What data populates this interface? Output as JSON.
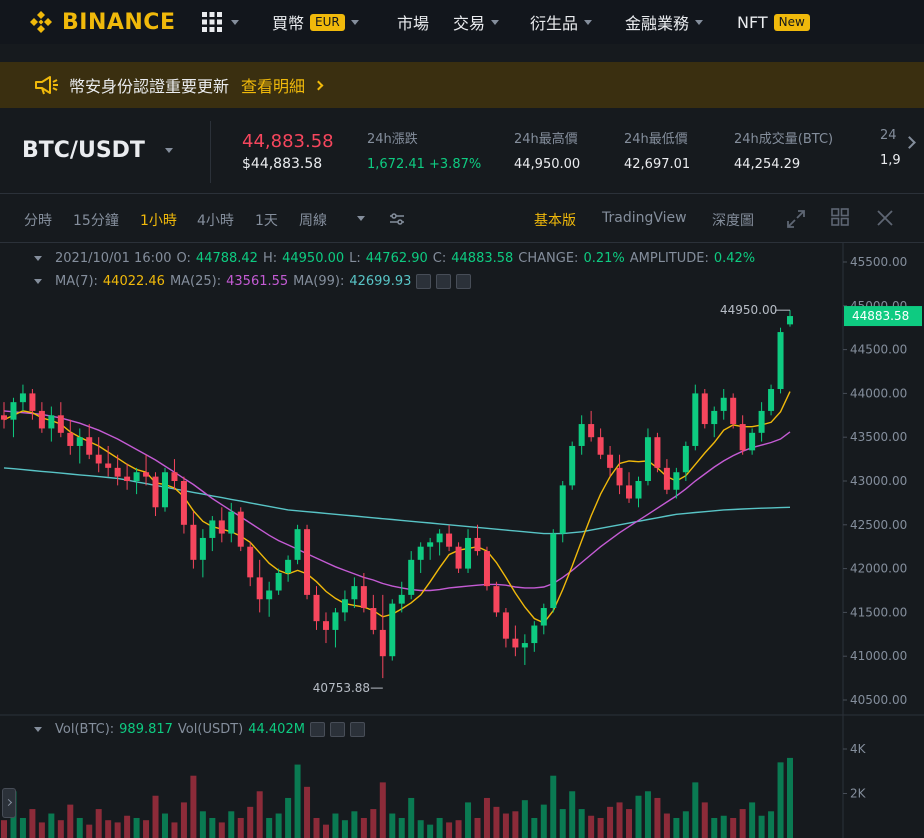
{
  "brand": {
    "name": "BINANCE",
    "color": "#f0b90b"
  },
  "nav": {
    "grid_icon": "grid-icon",
    "items": [
      {
        "label": "買幣",
        "badge": "EUR",
        "has_caret": true
      },
      {
        "label": "市場",
        "badge": "",
        "has_caret": false
      },
      {
        "label": "交易",
        "badge": "",
        "has_caret": true
      },
      {
        "label": "衍生品",
        "badge": "",
        "has_caret": true
      },
      {
        "label": "金融業務",
        "badge": "",
        "has_caret": true
      },
      {
        "label": "NFT",
        "badge": "New",
        "has_caret": false
      }
    ]
  },
  "banner": {
    "icon": "megaphone-icon",
    "text": "幣安身份認證重要更新",
    "link": "查看明細"
  },
  "ticker": {
    "pair": "BTC/USDT",
    "last_price": "44,883.58",
    "last_price_usd": "$44,883.58",
    "stats": [
      {
        "label": "24h漲跌",
        "value": "1,672.41 +3.87%",
        "green": true
      },
      {
        "label": "24h最高價",
        "value": "44,950.00",
        "green": false
      },
      {
        "label": "24h最低價",
        "value": "42,697.01",
        "green": false
      },
      {
        "label": "24h成交量(BTC)",
        "value": "44,254.29",
        "green": false
      },
      {
        "label": "24",
        "value": "1,9",
        "green": false
      }
    ]
  },
  "intervals": [
    "分時",
    "15分鐘",
    "1小時",
    "4小時",
    "1天",
    "周線"
  ],
  "active_interval": "1小時",
  "views": {
    "basic": "基本版",
    "tradingview": "TradingView",
    "depth": "深度圖"
  },
  "legend": {
    "date": "2021/10/01 16:00",
    "o_label": "O:",
    "o": "44788.42",
    "h_label": "H:",
    "h": "44950.00",
    "l_label": "L:",
    "l": "44762.90",
    "c_label": "C:",
    "c": "44883.58",
    "change_label": "CHANGE:",
    "change": "0.21%",
    "amp_label": "AMPLITUDE:",
    "amp": "0.42%",
    "ma7_label": "MA(7):",
    "ma7": "44022.46",
    "ma25_label": "MA(25):",
    "ma25": "43561.55",
    "ma99_label": "MA(99):",
    "ma99": "42699.93",
    "vol_btc_label": "Vol(BTC):",
    "vol_btc": "989.817",
    "vol_usdt_label": "Vol(USDT)",
    "vol_usdt": "44.402M"
  },
  "colors": {
    "up": "#0ecb81",
    "down": "#f6465d",
    "ma7": "#f0b90b",
    "ma25": "#c45bd4",
    "ma99": "#58c4c6",
    "bg": "#161a1e"
  },
  "chart_data": {
    "type": "candlestick",
    "price_ticks": [
      "45500.00",
      "45000.00",
      "44500.00",
      "44000.00",
      "43500.00",
      "43000.00",
      "42500.00",
      "42000.00",
      "41500.00",
      "41000.00",
      "40500.00"
    ],
    "price_tick_values": [
      45500,
      45000,
      44500,
      44000,
      43500,
      43000,
      42500,
      42000,
      41500,
      41000,
      40500
    ],
    "volume_ticks": [
      "4K",
      "2K"
    ],
    "volume_tick_values": [
      4000,
      2000
    ],
    "last_price_label": "44883.58",
    "high_label": "44950.00",
    "low_label": "40753.88",
    "candles": [
      [
        43750,
        43900,
        43600,
        43700
      ],
      [
        43700,
        43950,
        43500,
        43900
      ],
      [
        43900,
        44100,
        43800,
        44000
      ],
      [
        44000,
        44050,
        43700,
        43800
      ],
      [
        43800,
        43900,
        43550,
        43600
      ],
      [
        43600,
        43850,
        43450,
        43750
      ],
      [
        43750,
        43900,
        43500,
        43550
      ],
      [
        43550,
        43700,
        43300,
        43400
      ],
      [
        43400,
        43600,
        43200,
        43500
      ],
      [
        43500,
        43650,
        43250,
        43300
      ],
      [
        43300,
        43500,
        43100,
        43200
      ],
      [
        43200,
        43400,
        43050,
        43150
      ],
      [
        43150,
        43300,
        42950,
        43050
      ],
      [
        43050,
        43200,
        42900,
        43000
      ],
      [
        43000,
        43150,
        42850,
        43100
      ],
      [
        43100,
        43300,
        42950,
        43050
      ],
      [
        43050,
        43100,
        42600,
        42700
      ],
      [
        42700,
        43150,
        42650,
        43100
      ],
      [
        43100,
        43250,
        42900,
        43000
      ],
      [
        43000,
        43050,
        42400,
        42500
      ],
      [
        42500,
        42650,
        42000,
        42100
      ],
      [
        42100,
        42450,
        41900,
        42350
      ],
      [
        42350,
        42600,
        42200,
        42550
      ],
      [
        42550,
        42700,
        42300,
        42400
      ],
      [
        42400,
        42750,
        42300,
        42650
      ],
      [
        42650,
        42700,
        42200,
        42250
      ],
      [
        42250,
        42300,
        41800,
        41900
      ],
      [
        41900,
        42100,
        41500,
        41650
      ],
      [
        41650,
        41850,
        41450,
        41750
      ],
      [
        41750,
        42000,
        41700,
        41950
      ],
      [
        41950,
        42150,
        41850,
        42100
      ],
      [
        42100,
        42500,
        42050,
        42450
      ],
      [
        42450,
        42500,
        41650,
        41700
      ],
      [
        41700,
        41800,
        41300,
        41400
      ],
      [
        41400,
        41500,
        41150,
        41300
      ],
      [
        41300,
        41550,
        41100,
        41500
      ],
      [
        41500,
        41750,
        41400,
        41650
      ],
      [
        41650,
        41900,
        41550,
        41800
      ],
      [
        41800,
        41950,
        41500,
        41550
      ],
      [
        41550,
        41700,
        41250,
        41300
      ],
      [
        41300,
        41700,
        40750,
        41000
      ],
      [
        41000,
        41650,
        40950,
        41600
      ],
      [
        41600,
        41850,
        41500,
        41700
      ],
      [
        41700,
        42200,
        41650,
        42100
      ],
      [
        42100,
        42300,
        41950,
        42250
      ],
      [
        42250,
        42350,
        42100,
        42300
      ],
      [
        42300,
        42450,
        42150,
        42400
      ],
      [
        42400,
        42500,
        42200,
        42250
      ],
      [
        42250,
        42300,
        41950,
        42000
      ],
      [
        42000,
        42450,
        41950,
        42350
      ],
      [
        42350,
        42500,
        42150,
        42200
      ],
      [
        42200,
        42250,
        41750,
        41800
      ],
      [
        41800,
        41850,
        41450,
        41500
      ],
      [
        41500,
        41550,
        41100,
        41200
      ],
      [
        41200,
        41350,
        41000,
        41100
      ],
      [
        41100,
        41250,
        40900,
        41150
      ],
      [
        41150,
        41400,
        41050,
        41350
      ],
      [
        41350,
        41600,
        41250,
        41550
      ],
      [
        41550,
        42450,
        41500,
        42400
      ],
      [
        42400,
        43000,
        42300,
        42950
      ],
      [
        42950,
        43450,
        42900,
        43400
      ],
      [
        43400,
        43750,
        43300,
        43650
      ],
      [
        43650,
        43800,
        43450,
        43500
      ],
      [
        43500,
        43600,
        43250,
        43300
      ],
      [
        43300,
        43400,
        43050,
        43150
      ],
      [
        43150,
        43300,
        42850,
        42950
      ],
      [
        42950,
        43100,
        42750,
        42800
      ],
      [
        42800,
        43050,
        42700,
        43000
      ],
      [
        43000,
        43600,
        42950,
        43500
      ],
      [
        43500,
        43550,
        43100,
        43150
      ],
      [
        43150,
        43250,
        42850,
        42900
      ],
      [
        42900,
        43150,
        42800,
        43100
      ],
      [
        43100,
        43450,
        43000,
        43400
      ],
      [
        43400,
        44100,
        43350,
        44000
      ],
      [
        44000,
        44050,
        43600,
        43650
      ],
      [
        43650,
        43850,
        43500,
        43800
      ],
      [
        43800,
        44050,
        43700,
        43950
      ],
      [
        43950,
        44000,
        43600,
        43650
      ],
      [
        43650,
        43750,
        43300,
        43350
      ],
      [
        43350,
        43600,
        43300,
        43550
      ],
      [
        43550,
        43900,
        43450,
        43800
      ],
      [
        43800,
        44100,
        43750,
        44050
      ],
      [
        44050,
        44750,
        44000,
        44700
      ],
      [
        44788,
        44950,
        44762,
        44883
      ]
    ],
    "ma7": [
      43700,
      43750,
      43800,
      43780,
      43720,
      43690,
      43650,
      43560,
      43500,
      43450,
      43400,
      43330,
      43260,
      43190,
      43130,
      43100,
      42980,
      42960,
      42920,
      42820,
      42660,
      42540,
      42480,
      42450,
      42420,
      42370,
      42300,
      42180,
      42060,
      41980,
      41940,
      41980,
      41940,
      41850,
      41740,
      41660,
      41600,
      41580,
      41560,
      41520,
      41450,
      41480,
      41540,
      41610,
      41700,
      41850,
      42010,
      42160,
      42210,
      42230,
      42250,
      42200,
      42070,
      41900,
      41720,
      41560,
      41430,
      41380,
      41520,
      41760,
      42030,
      42320,
      42600,
      42850,
      43050,
      43200,
      43230,
      43220,
      43230,
      43150,
      43050,
      43000,
      43060,
      43190,
      43320,
      43440,
      43580,
      43640,
      43620,
      43620,
      43640,
      43670,
      43790,
      44020
    ],
    "ma25": [
      43800,
      43790,
      43780,
      43770,
      43760,
      43740,
      43720,
      43690,
      43660,
      43620,
      43580,
      43530,
      43480,
      43420,
      43360,
      43300,
      43240,
      43170,
      43100,
      43030,
      42960,
      42880,
      42800,
      42730,
      42660,
      42590,
      42520,
      42450,
      42380,
      42320,
      42270,
      42220,
      42170,
      42120,
      42070,
      42020,
      41980,
      41940,
      41900,
      41870,
      41830,
      41800,
      41780,
      41760,
      41750,
      41750,
      41760,
      41780,
      41790,
      41800,
      41810,
      41820,
      41820,
      41810,
      41790,
      41780,
      41780,
      41790,
      41830,
      41900,
      41980,
      42070,
      42160,
      42250,
      42330,
      42410,
      42480,
      42550,
      42620,
      42690,
      42760,
      42830,
      42910,
      43000,
      43080,
      43160,
      43230,
      43290,
      43340,
      43380,
      43410,
      43440,
      43480,
      43560
    ],
    "ma99": [
      43150,
      43140,
      43130,
      43120,
      43110,
      43100,
      43090,
      43080,
      43070,
      43060,
      43050,
      43040,
      43030,
      43010,
      42990,
      42970,
      42950,
      42930,
      42910,
      42890,
      42870,
      42850,
      42830,
      42810,
      42790,
      42770,
      42750,
      42730,
      42710,
      42690,
      42670,
      42660,
      42650,
      42640,
      42630,
      42620,
      42610,
      42600,
      42590,
      42580,
      42570,
      42560,
      42550,
      42540,
      42530,
      42520,
      42510,
      42500,
      42490,
      42480,
      42470,
      42460,
      42450,
      42440,
      42430,
      42420,
      42410,
      42400,
      42400,
      42400,
      42410,
      42420,
      42440,
      42460,
      42480,
      42500,
      42520,
      42540,
      42560,
      42580,
      42600,
      42620,
      42630,
      42640,
      42650,
      42660,
      42670,
      42675,
      42680,
      42685,
      42690,
      42693,
      42696,
      42700
    ],
    "volumes": [
      800,
      2100,
      900,
      1300,
      700,
      1100,
      800,
      1500,
      900,
      600,
      1300,
      800,
      700,
      1000,
      900,
      800,
      1900,
      1100,
      700,
      1600,
      2800,
      1200,
      900,
      700,
      1200,
      900,
      1400,
      2100,
      900,
      1100,
      1800,
      3300,
      2300,
      900,
      600,
      1100,
      800,
      1200,
      900,
      1300,
      2500,
      1100,
      900,
      1800,
      800,
      600,
      900,
      700,
      800,
      1600,
      900,
      1800,
      1400,
      1100,
      1200,
      1700,
      900,
      1500,
      2800,
      1300,
      2100,
      1300,
      1000,
      900,
      1400,
      1600,
      1300,
      1900,
      2100,
      1800,
      1100,
      900,
      1200,
      2500,
      1600,
      900,
      1000,
      900,
      1300,
      1600,
      1000,
      1200,
      3400,
      3600
    ]
  }
}
